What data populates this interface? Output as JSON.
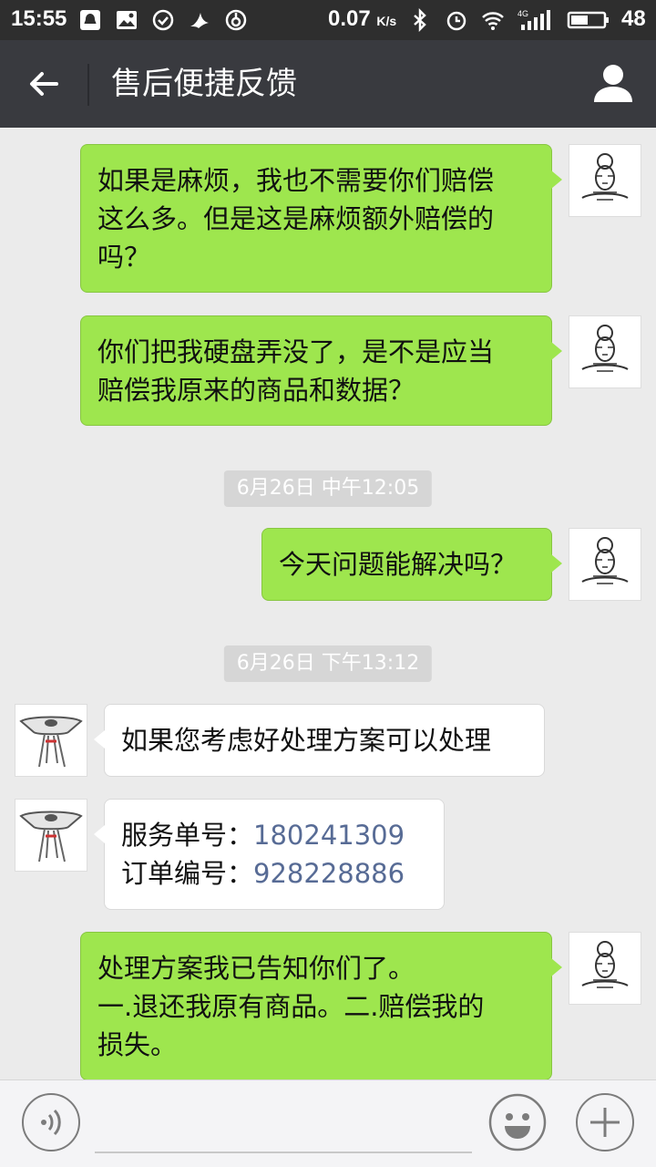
{
  "status_bar": {
    "time": "15:55",
    "speed": "0.07",
    "speed_unit": "K/s",
    "network": "4G",
    "battery": "48"
  },
  "header": {
    "title": "售后便捷反馈"
  },
  "messages": [
    {
      "sender": "me",
      "lines": [
        "如果是麻烦，我也不需要你们赔偿",
        "这么多。但是这是麻烦额外赔偿的",
        "吗？"
      ]
    },
    {
      "sender": "me",
      "lines": [
        "你们把我硬盘弄没了，是不是应当",
        "赔偿我原来的商品和数据？"
      ]
    },
    {
      "type": "timestamp",
      "text": "6月26日 中午12:05"
    },
    {
      "sender": "me",
      "lines": [
        "今天问题能解决吗？"
      ]
    },
    {
      "type": "timestamp",
      "text": "6月26日 下午13:12"
    },
    {
      "sender": "other",
      "lines": [
        "如果您考虑好处理方案可以处理"
      ]
    },
    {
      "sender": "other",
      "service_label": "服务单号：",
      "service_no": "180241309",
      "order_label": "订单编号：",
      "order_no": "928228886"
    },
    {
      "sender": "me",
      "lines": [
        "处理方案我已告知你们了。",
        "一.退还我原有商品。二.赔偿我的",
        "损失。"
      ]
    }
  ],
  "colors": {
    "my_bubble": "#9ee64e",
    "other_bubble": "#ffffff",
    "link_number": "#576b95",
    "header_bg": "#393a3f"
  }
}
